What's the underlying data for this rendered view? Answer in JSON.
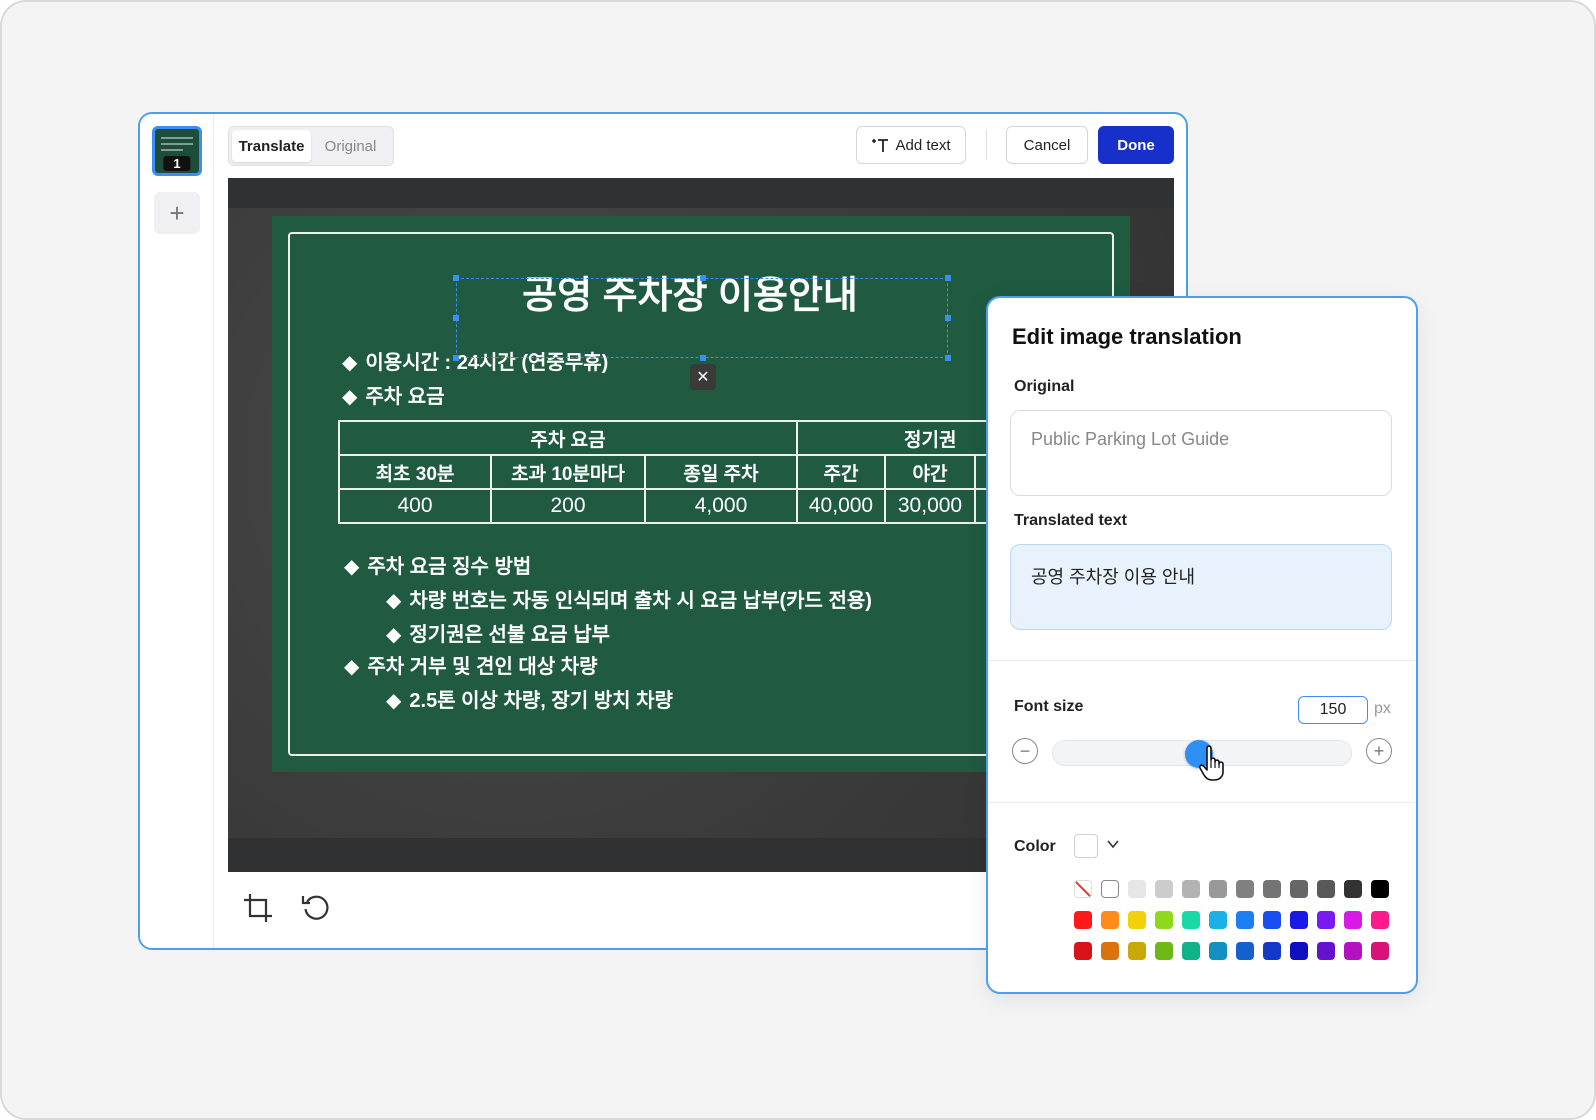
{
  "pages": {
    "thumb_number": "1",
    "add_icon": "plus-icon"
  },
  "toolbar": {
    "mode_tabs": [
      {
        "label": "Translate",
        "active": true
      },
      {
        "label": "Original",
        "active": false
      }
    ],
    "add_text_label": "Add text",
    "cancel_label": "Cancel",
    "done_label": "Done"
  },
  "sign": {
    "title": "공영 주차장 이용안내",
    "hours": "이용시간 : 24시간 (연중무휴)",
    "fee_heading": "주차 요금",
    "table": {
      "group_fee": "주차 요금",
      "group_pass": "정기권",
      "headers": [
        "최초 30분",
        "초과 10분마다",
        "종일 주차",
        "주간",
        "야간"
      ],
      "values": [
        "400",
        "200",
        "4,000",
        "40,000",
        "30,000"
      ]
    },
    "method_heading": "주차 요금 징수 방법",
    "method_items": [
      "차량 번호는 자동 인식되며 출차 시 요금 납부(카드 전용)",
      "정기권은 선불 요금 납부"
    ],
    "refuse_heading": "주차 거부 및 견인 대상 차량",
    "refuse_items": [
      "2.5톤 이상 차량, 장기 방치 차량"
    ],
    "bullet": "◆"
  },
  "panel": {
    "title": "Edit image translation",
    "original_label": "Original",
    "original_text": "Public Parking Lot Guide",
    "translated_label": "Translated text",
    "translated_text": "공영 주차장 이용 안내",
    "font_size_label": "Font size",
    "font_size_value": "150",
    "font_size_unit": "px",
    "font_size_fraction": 0.49,
    "color_label": "Color",
    "palette_rows": [
      [
        "none",
        "#ffffff",
        "#e6e6e6",
        "#cccccc",
        "#b3b3b3",
        "#999999",
        "#808080",
        "#737373",
        "#666666",
        "#595959",
        "#333333",
        "#000000"
      ],
      [
        "#ff1a1a",
        "#ff8c1a",
        "#f2d10a",
        "#8fd91a",
        "#1ad9a6",
        "#1ab2e6",
        "#1a7ff2",
        "#1a4df2",
        "#1a1ae6",
        "#7a1af2",
        "#d91ae6",
        "#ff1a8c"
      ],
      [
        "#d9131a",
        "#d9730f",
        "#c9a80a",
        "#6fb81a",
        "#12b288",
        "#1290c2",
        "#1460cc",
        "#1438c9",
        "#0f0fbf",
        "#6412cc",
        "#b312bf",
        "#d9127a"
      ]
    ]
  },
  "colors": {
    "accent": "#3b8ef5",
    "done_button": "#1730c9",
    "board_green": "#1f5a41"
  }
}
